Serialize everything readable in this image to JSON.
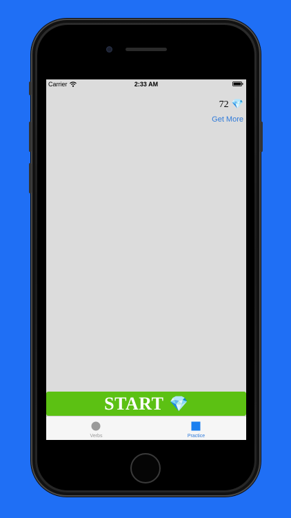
{
  "status_bar": {
    "carrier": "Carrier",
    "time": "2:33 AM",
    "wifi_icon": "wifi-icon",
    "battery_icon": "battery-icon"
  },
  "header": {
    "gem_count": "72",
    "gem_icon": "💎",
    "get_more_label": "Get More"
  },
  "main": {
    "start_label": "START",
    "start_icon": "💎"
  },
  "tab_bar": {
    "tabs": [
      {
        "label": "Verbs",
        "icon": "circle-icon",
        "active": false
      },
      {
        "label": "Practice",
        "icon": "square-icon",
        "active": true
      }
    ]
  },
  "colors": {
    "background": "#1f6ff5",
    "screen": "#dcdcdc",
    "start_button": "#5cc113",
    "accent": "#2f7ad9",
    "tab_inactive": "#9a9a9a"
  }
}
